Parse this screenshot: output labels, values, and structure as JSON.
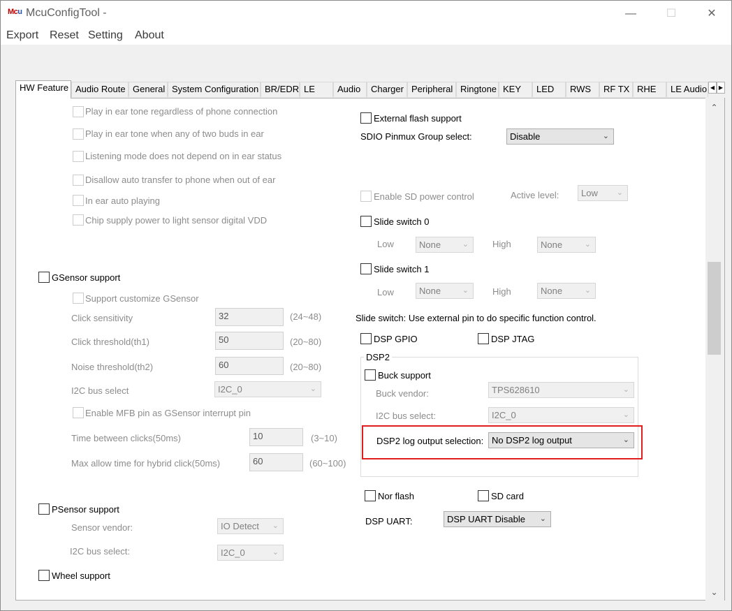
{
  "window": {
    "title": "McuConfigTool -",
    "icon_text_1": "Mc",
    "icon_text_2": "u"
  },
  "menu": [
    "Export",
    "Reset",
    "Setting",
    "About"
  ],
  "tabs": [
    "HW Feature",
    "Audio Route",
    "General",
    "System Configuration",
    "BR/EDR",
    "LE",
    "Audio",
    "Charger",
    "Peripheral",
    "Ringtone",
    "KEY",
    "LED",
    "RWS",
    "RF TX",
    "RHE",
    "LE Audio"
  ],
  "left": {
    "ear_options": [
      "Play in ear tone regardless of phone connection",
      "Play in ear tone when any of two buds in ear",
      "Listening mode does not depend on in ear status",
      "Disallow auto transfer to phone when out of ear",
      "In ear auto playing",
      "Chip supply power to light sensor digital VDD"
    ],
    "gsensor": {
      "label": "GSensor support",
      "customize": "Support customize GSensor",
      "click_sensitivity": {
        "label": "Click sensitivity",
        "value": "32",
        "range": "(24~48)"
      },
      "click_threshold": {
        "label": "Click threshold(th1)",
        "value": "50",
        "range": "(20~80)"
      },
      "noise_threshold": {
        "label": "Noise threshold(th2)",
        "value": "60",
        "range": "(20~80)"
      },
      "i2c": {
        "label": "I2C bus select",
        "value": "I2C_0"
      },
      "mfb": "Enable MFB pin as GSensor interrupt pin",
      "time_between": {
        "label": "Time between clicks(50ms)",
        "value": "10",
        "range": "(3~10)"
      },
      "max_hybrid": {
        "label": "Max allow time for hybrid click(50ms)",
        "value": "60",
        "range": "(60~100)"
      }
    },
    "psensor": {
      "label": "PSensor support",
      "vendor": {
        "label": "Sensor vendor:",
        "value": "IO Detect"
      },
      "i2c": {
        "label": "I2C bus select:",
        "value": "I2C_0"
      }
    },
    "wheel": "Wheel support"
  },
  "right": {
    "external_flash": "External flash support",
    "sdio": {
      "label": "SDIO Pinmux Group select:",
      "value": "Disable"
    },
    "sd_power": "Enable SD power control",
    "active_level": {
      "label": "Active level:",
      "value": "Low"
    },
    "slide0": {
      "label": "Slide switch 0",
      "low": "Low",
      "low_value": "None",
      "high": "High",
      "high_value": "None"
    },
    "slide1": {
      "label": "Slide switch 1",
      "low": "Low",
      "low_value": "None",
      "high": "High",
      "high_value": "None"
    },
    "slide_note": "Slide switch: Use external pin to do specific function control.",
    "dsp_gpio": "DSP GPIO",
    "dsp_jtag": "DSP JTAG",
    "dsp2": {
      "title": "DSP2",
      "buck": "Buck support",
      "buck_vendor": {
        "label": "Buck vendor:",
        "value": "TPS628610"
      },
      "i2c": {
        "label": "I2C bus select:",
        "value": "I2C_0"
      },
      "log": {
        "label": "DSP2 log output selection:",
        "value": "No DSP2 log output"
      }
    },
    "nor_flash": "Nor flash",
    "sd_card": "SD card",
    "dsp_uart": {
      "label": "DSP UART:",
      "value": "DSP UART Disable"
    }
  },
  "colors": {
    "highlight": "#e01e1e",
    "panel": "#ffffff",
    "window_bg": "#f0f0f0"
  }
}
